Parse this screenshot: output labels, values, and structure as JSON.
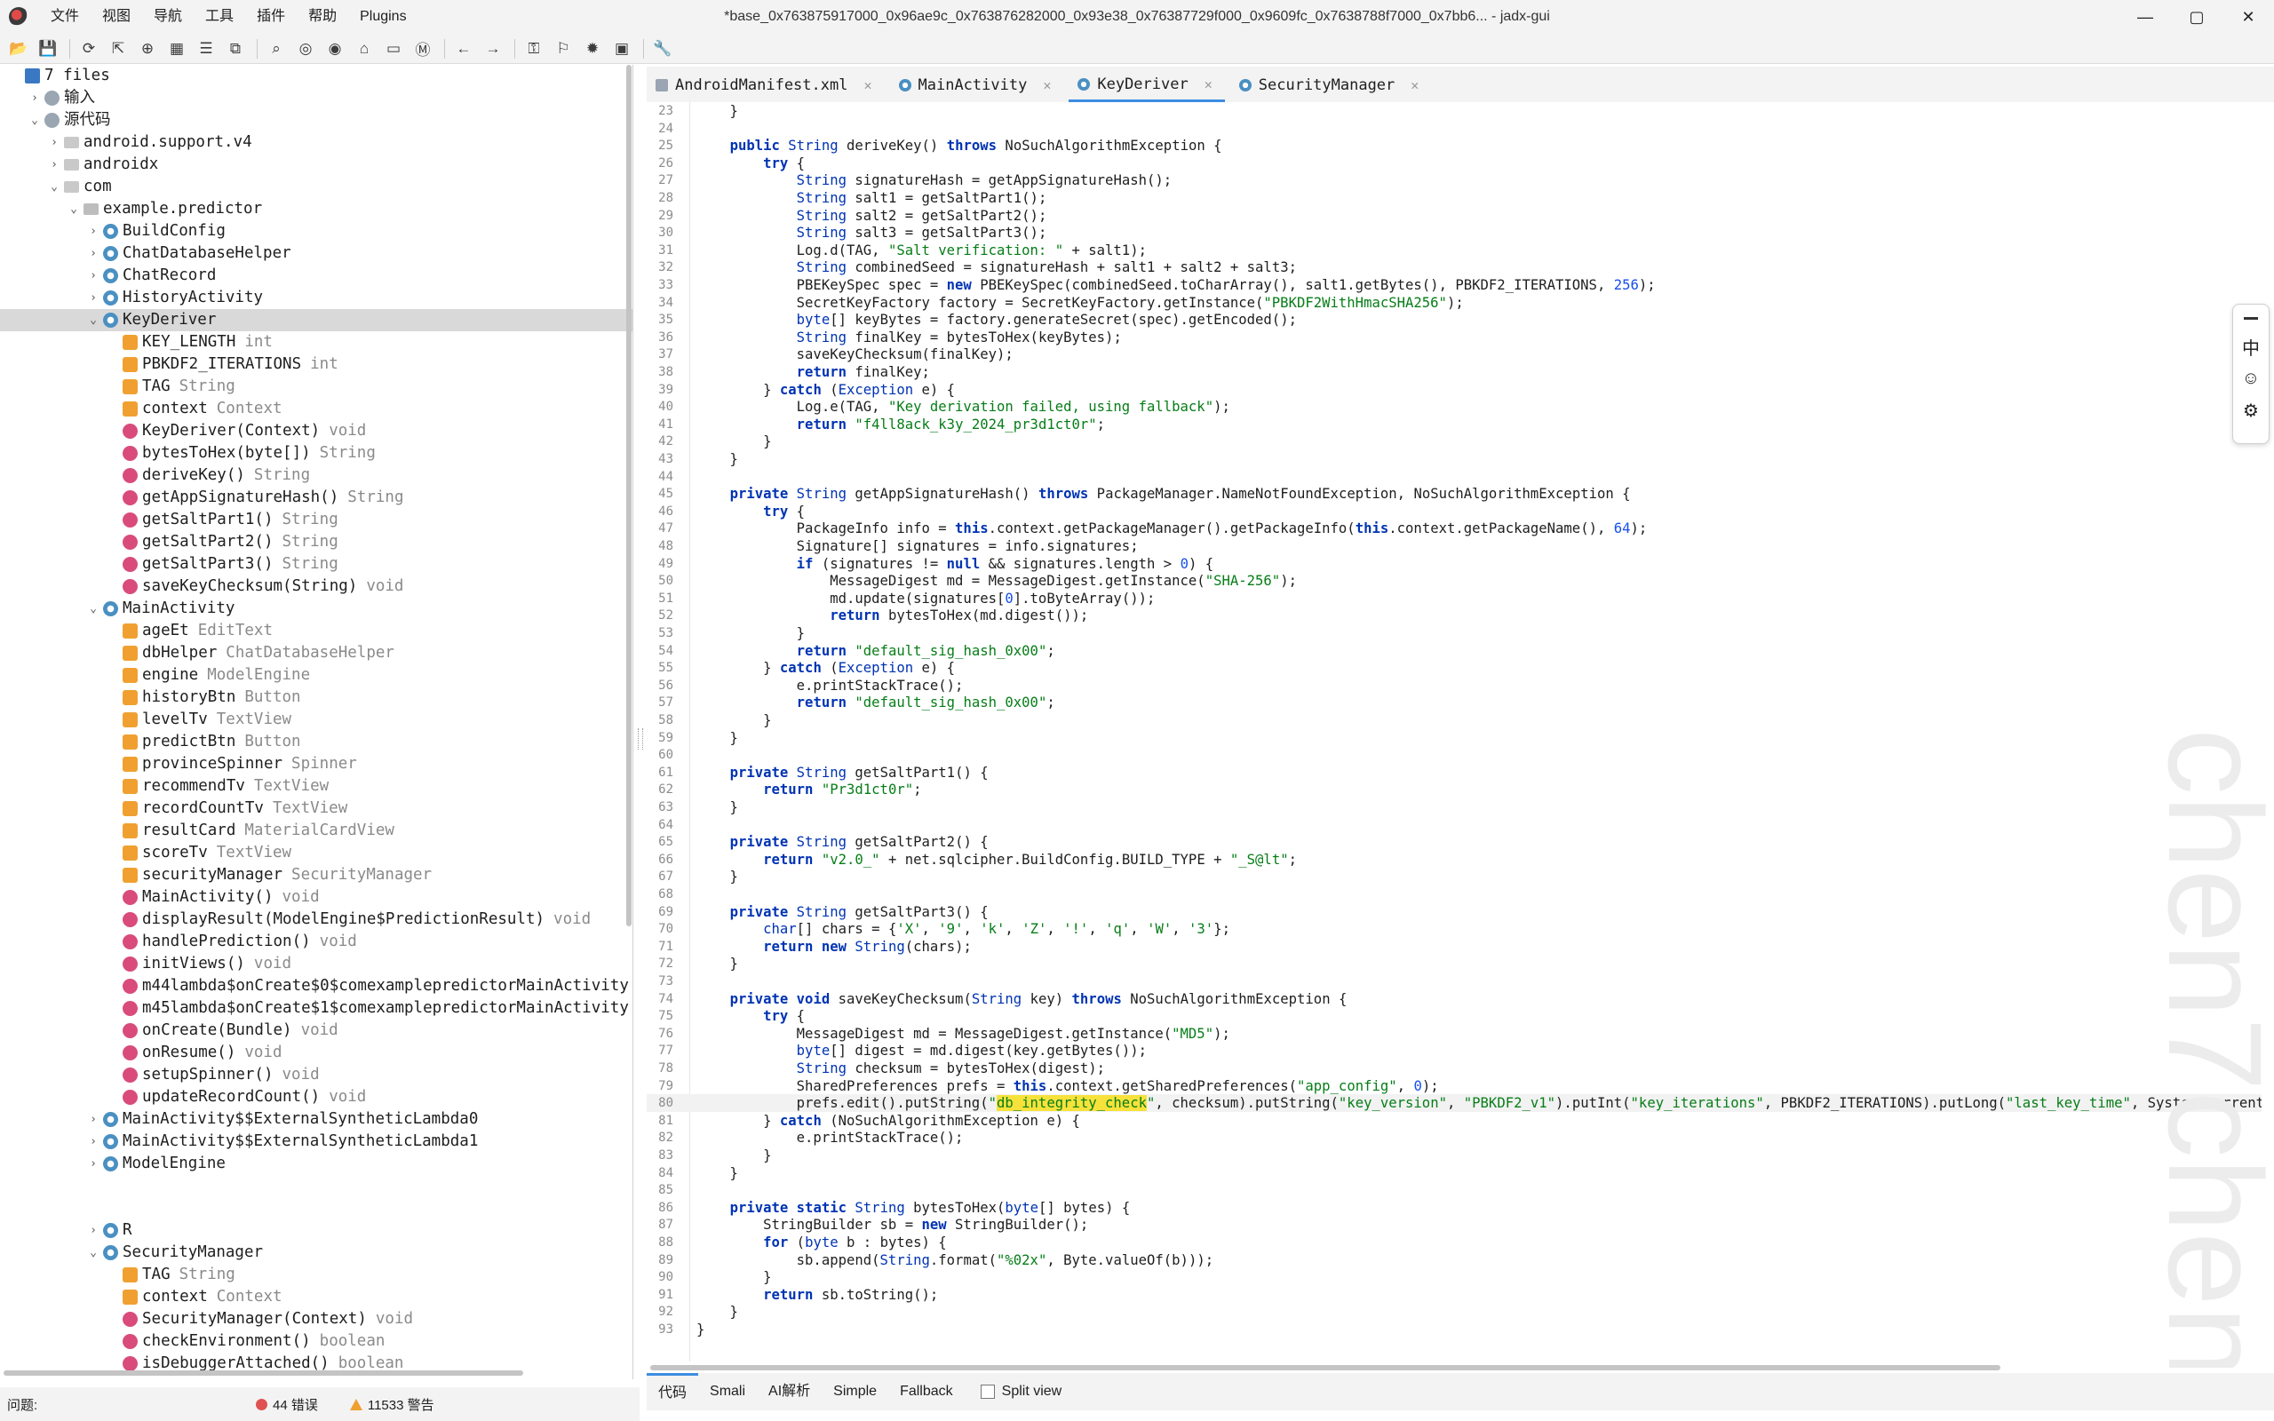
{
  "titlebar": {
    "menus": [
      "文件",
      "视图",
      "导航",
      "工具",
      "插件",
      "帮助",
      "Plugins"
    ],
    "title": "*base_0x763875917000_0x96ae9c_0x763876282000_0x93e38_0x76387729f000_0x9609fc_0x7638788f7000_0x7bb6... - jadx-gui",
    "controls": {
      "minimize": "—",
      "maximize": "▢",
      "close": "✕"
    }
  },
  "toolbar": {
    "icons": [
      "open-file-icon",
      "save-all-icon",
      "sync-icon",
      "export-icon",
      "flatten-icon",
      "package-icon",
      "stack-icon",
      "copy-icon",
      "search-icon",
      "find-usage-icon",
      "search-class-icon",
      "home-icon",
      "decompile-icon",
      "method-icon",
      "back-icon",
      "forward-icon",
      "deobfuscation-icon",
      "bookmark-icon",
      "debug-icon",
      "log-icon",
      "settings-icon"
    ]
  },
  "tree": {
    "rows": [
      {
        "label": "7 files",
        "type": "",
        "indent": 0,
        "icon": "ico-root",
        "arrow": ""
      },
      {
        "label": "输入",
        "type": "",
        "indent": 1,
        "icon": "ico-src",
        "arrow": "›"
      },
      {
        "label": "源代码",
        "type": "",
        "indent": 1,
        "icon": "ico-src",
        "arrow": "⌄"
      },
      {
        "label": "android.support.v4",
        "type": "",
        "indent": 2,
        "icon": "ico-folder",
        "arrow": "›"
      },
      {
        "label": "androidx",
        "type": "",
        "indent": 2,
        "icon": "ico-folder",
        "arrow": "›"
      },
      {
        "label": "com",
        "type": "",
        "indent": 2,
        "icon": "ico-folder",
        "arrow": "⌄"
      },
      {
        "label": "example.predictor",
        "type": "",
        "indent": 3,
        "icon": "ico-pkg",
        "arrow": "⌄"
      },
      {
        "label": "BuildConfig",
        "type": "",
        "indent": 4,
        "icon": "ico-class",
        "arrow": "›"
      },
      {
        "label": "ChatDatabaseHelper",
        "type": "",
        "indent": 4,
        "icon": "ico-class",
        "arrow": "›"
      },
      {
        "label": "ChatRecord",
        "type": "",
        "indent": 4,
        "icon": "ico-class",
        "arrow": "›"
      },
      {
        "label": "HistoryActivity",
        "type": "",
        "indent": 4,
        "icon": "ico-class",
        "arrow": "›"
      },
      {
        "label": "KeyDeriver",
        "type": "",
        "indent": 4,
        "icon": "ico-class",
        "arrow": "⌄",
        "selected": true
      },
      {
        "label": "KEY_LENGTH",
        "type": "int",
        "indent": 5,
        "icon": "ico-field-s",
        "arrow": ""
      },
      {
        "label": "PBKDF2_ITERATIONS",
        "type": "int",
        "indent": 5,
        "icon": "ico-field-s",
        "arrow": ""
      },
      {
        "label": "TAG",
        "type": "String",
        "indent": 5,
        "icon": "ico-field-s",
        "arrow": ""
      },
      {
        "label": "context",
        "type": "Context",
        "indent": 5,
        "icon": "ico-field",
        "arrow": ""
      },
      {
        "label": "KeyDeriver(Context)",
        "type": "void",
        "indent": 5,
        "icon": "ico-method",
        "arrow": ""
      },
      {
        "label": "bytesToHex(byte[])",
        "type": "String",
        "indent": 5,
        "icon": "ico-method",
        "arrow": ""
      },
      {
        "label": "deriveKey()",
        "type": "String",
        "indent": 5,
        "icon": "ico-method",
        "arrow": ""
      },
      {
        "label": "getAppSignatureHash()",
        "type": "String",
        "indent": 5,
        "icon": "ico-method",
        "arrow": ""
      },
      {
        "label": "getSaltPart1()",
        "type": "String",
        "indent": 5,
        "icon": "ico-method",
        "arrow": ""
      },
      {
        "label": "getSaltPart2()",
        "type": "String",
        "indent": 5,
        "icon": "ico-method",
        "arrow": ""
      },
      {
        "label": "getSaltPart3()",
        "type": "String",
        "indent": 5,
        "icon": "ico-method",
        "arrow": ""
      },
      {
        "label": "saveKeyChecksum(String)",
        "type": "void",
        "indent": 5,
        "icon": "ico-method",
        "arrow": ""
      },
      {
        "label": "MainActivity",
        "type": "",
        "indent": 4,
        "icon": "ico-class",
        "arrow": "⌄"
      },
      {
        "label": "ageEt",
        "type": "EditText",
        "indent": 5,
        "icon": "ico-field",
        "arrow": ""
      },
      {
        "label": "dbHelper",
        "type": "ChatDatabaseHelper",
        "indent": 5,
        "icon": "ico-field",
        "arrow": ""
      },
      {
        "label": "engine",
        "type": "ModelEngine",
        "indent": 5,
        "icon": "ico-field",
        "arrow": ""
      },
      {
        "label": "historyBtn",
        "type": "Button",
        "indent": 5,
        "icon": "ico-field",
        "arrow": ""
      },
      {
        "label": "levelTv",
        "type": "TextView",
        "indent": 5,
        "icon": "ico-field",
        "arrow": ""
      },
      {
        "label": "predictBtn",
        "type": "Button",
        "indent": 5,
        "icon": "ico-field",
        "arrow": ""
      },
      {
        "label": "provinceSpinner",
        "type": "Spinner",
        "indent": 5,
        "icon": "ico-field",
        "arrow": ""
      },
      {
        "label": "recommendTv",
        "type": "TextView",
        "indent": 5,
        "icon": "ico-field",
        "arrow": ""
      },
      {
        "label": "recordCountTv",
        "type": "TextView",
        "indent": 5,
        "icon": "ico-field",
        "arrow": ""
      },
      {
        "label": "resultCard",
        "type": "MaterialCardView",
        "indent": 5,
        "icon": "ico-field",
        "arrow": ""
      },
      {
        "label": "scoreTv",
        "type": "TextView",
        "indent": 5,
        "icon": "ico-field",
        "arrow": ""
      },
      {
        "label": "securityManager",
        "type": "SecurityManager",
        "indent": 5,
        "icon": "ico-field",
        "arrow": ""
      },
      {
        "label": "MainActivity()",
        "type": "void",
        "indent": 5,
        "icon": "ico-method",
        "arrow": ""
      },
      {
        "label": "displayResult(ModelEngine$PredictionResult)",
        "type": "void",
        "indent": 5,
        "icon": "ico-method",
        "arrow": ""
      },
      {
        "label": "handlePrediction()",
        "type": "void",
        "indent": 5,
        "icon": "ico-method",
        "arrow": ""
      },
      {
        "label": "initViews()",
        "type": "void",
        "indent": 5,
        "icon": "ico-method",
        "arrow": ""
      },
      {
        "label": "m44lambda$onCreate$0$comexamplepredictorMainActivity",
        "type": "",
        "indent": 5,
        "icon": "ico-method",
        "arrow": ""
      },
      {
        "label": "m45lambda$onCreate$1$comexamplepredictorMainActivity",
        "type": "",
        "indent": 5,
        "icon": "ico-method",
        "arrow": ""
      },
      {
        "label": "onCreate(Bundle)",
        "type": "void",
        "indent": 5,
        "icon": "ico-method",
        "arrow": ""
      },
      {
        "label": "onResume()",
        "type": "void",
        "indent": 5,
        "icon": "ico-method",
        "arrow": ""
      },
      {
        "label": "setupSpinner()",
        "type": "void",
        "indent": 5,
        "icon": "ico-method",
        "arrow": ""
      },
      {
        "label": "updateRecordCount()",
        "type": "void",
        "indent": 5,
        "icon": "ico-method",
        "arrow": ""
      },
      {
        "label": "MainActivity$$ExternalSyntheticLambda0",
        "type": "",
        "indent": 4,
        "icon": "ico-class",
        "arrow": "›"
      },
      {
        "label": "MainActivity$$ExternalSyntheticLambda1",
        "type": "",
        "indent": 4,
        "icon": "ico-class",
        "arrow": "›"
      },
      {
        "label": "ModelEngine",
        "type": "",
        "indent": 4,
        "icon": "ico-class",
        "arrow": "›"
      },
      {
        "label": "",
        "type": "",
        "indent": 4,
        "icon": "",
        "arrow": ""
      },
      {
        "label": "",
        "type": "",
        "indent": 4,
        "icon": "",
        "arrow": ""
      },
      {
        "label": "R",
        "type": "",
        "indent": 4,
        "icon": "ico-class",
        "arrow": "›"
      },
      {
        "label": "SecurityManager",
        "type": "",
        "indent": 4,
        "icon": "ico-class",
        "arrow": "⌄"
      },
      {
        "label": "TAG",
        "type": "String",
        "indent": 5,
        "icon": "ico-field-s",
        "arrow": ""
      },
      {
        "label": "context",
        "type": "Context",
        "indent": 5,
        "icon": "ico-field",
        "arrow": ""
      },
      {
        "label": "SecurityManager(Context)",
        "type": "void",
        "indent": 5,
        "icon": "ico-method",
        "arrow": ""
      },
      {
        "label": "checkEnvironment()",
        "type": "boolean",
        "indent": 5,
        "icon": "ico-method",
        "arrow": ""
      },
      {
        "label": "isDebuggerAttached()",
        "type": "boolean",
        "indent": 5,
        "icon": "ico-method",
        "arrow": ""
      }
    ]
  },
  "editor": {
    "tabs": [
      {
        "label": "AndroidManifest.xml",
        "icon": "xml",
        "active": false
      },
      {
        "label": "MainActivity",
        "icon": "cls",
        "active": false
      },
      {
        "label": "KeyDeriver",
        "icon": "cls",
        "active": true
      },
      {
        "label": "SecurityManager",
        "icon": "cls",
        "active": false
      }
    ],
    "close_glyph": "✕",
    "current_line": 80,
    "lines": [
      {
        "n": 23,
        "code": "    }"
      },
      {
        "n": 24,
        "code": ""
      },
      {
        "n": 25,
        "code": "    public String deriveKey() throws NoSuchAlgorithmException {"
      },
      {
        "n": 26,
        "code": "        try {"
      },
      {
        "n": 27,
        "code": "            String signatureHash = getAppSignatureHash();"
      },
      {
        "n": 28,
        "code": "            String salt1 = getSaltPart1();"
      },
      {
        "n": 29,
        "code": "            String salt2 = getSaltPart2();"
      },
      {
        "n": 30,
        "code": "            String salt3 = getSaltPart3();"
      },
      {
        "n": 31,
        "code": "            Log.d(TAG, \"Salt verification: \" + salt1);"
      },
      {
        "n": 32,
        "code": "            String combinedSeed = signatureHash + salt1 + salt2 + salt3;"
      },
      {
        "n": 33,
        "code": "            PBEKeySpec spec = new PBEKeySpec(combinedSeed.toCharArray(), salt1.getBytes(), PBKDF2_ITERATIONS, 256);"
      },
      {
        "n": 34,
        "code": "            SecretKeyFactory factory = SecretKeyFactory.getInstance(\"PBKDF2WithHmacSHA256\");"
      },
      {
        "n": 35,
        "code": "            byte[] keyBytes = factory.generateSecret(spec).getEncoded();"
      },
      {
        "n": 36,
        "code": "            String finalKey = bytesToHex(keyBytes);"
      },
      {
        "n": 37,
        "code": "            saveKeyChecksum(finalKey);"
      },
      {
        "n": 38,
        "code": "            return finalKey;"
      },
      {
        "n": 39,
        "code": "        } catch (Exception e) {"
      },
      {
        "n": 40,
        "code": "            Log.e(TAG, \"Key derivation failed, using fallback\");"
      },
      {
        "n": 41,
        "code": "            return \"f4ll8ack_k3y_2024_pr3d1ct0r\";"
      },
      {
        "n": 42,
        "code": "        }"
      },
      {
        "n": 43,
        "code": "    }"
      },
      {
        "n": 44,
        "code": ""
      },
      {
        "n": 45,
        "code": "    private String getAppSignatureHash() throws PackageManager.NameNotFoundException, NoSuchAlgorithmException {"
      },
      {
        "n": 46,
        "code": "        try {"
      },
      {
        "n": 47,
        "code": "            PackageInfo info = this.context.getPackageManager().getPackageInfo(this.context.getPackageName(), 64);"
      },
      {
        "n": 48,
        "code": "            Signature[] signatures = info.signatures;"
      },
      {
        "n": 49,
        "code": "            if (signatures != null && signatures.length > 0) {"
      },
      {
        "n": 50,
        "code": "                MessageDigest md = MessageDigest.getInstance(\"SHA-256\");"
      },
      {
        "n": 51,
        "code": "                md.update(signatures[0].toByteArray());"
      },
      {
        "n": 52,
        "code": "                return bytesToHex(md.digest());"
      },
      {
        "n": 53,
        "code": "            }"
      },
      {
        "n": 54,
        "code": "            return \"default_sig_hash_0x00\";"
      },
      {
        "n": 55,
        "code": "        } catch (Exception e) {"
      },
      {
        "n": 56,
        "code": "            e.printStackTrace();"
      },
      {
        "n": 57,
        "code": "            return \"default_sig_hash_0x00\";"
      },
      {
        "n": 58,
        "code": "        }"
      },
      {
        "n": 59,
        "code": "    }"
      },
      {
        "n": 60,
        "code": ""
      },
      {
        "n": 61,
        "code": "    private String getSaltPart1() {"
      },
      {
        "n": 62,
        "code": "        return \"Pr3d1ct0r\";"
      },
      {
        "n": 63,
        "code": "    }"
      },
      {
        "n": 64,
        "code": ""
      },
      {
        "n": 65,
        "code": "    private String getSaltPart2() {"
      },
      {
        "n": 66,
        "code": "        return \"v2.0_\" + net.sqlcipher.BuildConfig.BUILD_TYPE + \"_S@lt\";"
      },
      {
        "n": 67,
        "code": "    }"
      },
      {
        "n": 68,
        "code": ""
      },
      {
        "n": 69,
        "code": "    private String getSaltPart3() {"
      },
      {
        "n": 70,
        "code": "        char[] chars = {'X', '9', 'k', 'Z', '!', 'q', 'W', '3'};"
      },
      {
        "n": 71,
        "code": "        return new String(chars);"
      },
      {
        "n": 72,
        "code": "    }"
      },
      {
        "n": 73,
        "code": ""
      },
      {
        "n": 74,
        "code": "    private void saveKeyChecksum(String key) throws NoSuchAlgorithmException {"
      },
      {
        "n": 75,
        "code": "        try {"
      },
      {
        "n": 76,
        "code": "            MessageDigest md = MessageDigest.getInstance(\"MD5\");"
      },
      {
        "n": 77,
        "code": "            byte[] digest = md.digest(key.getBytes());"
      },
      {
        "n": 78,
        "code": "            String checksum = bytesToHex(digest);"
      },
      {
        "n": 79,
        "code": "            SharedPreferences prefs = this.context.getSharedPreferences(\"app_config\", 0);"
      },
      {
        "n": 80,
        "code": "            prefs.edit().putString(\"db_integrity_check\", checksum).putString(\"key_version\", \"PBKDF2_v1\").putInt(\"key_iterations\", PBKDF2_ITERATIONS).putLong(\"last_key_time\", System.currentTimeMill:"
      },
      {
        "n": 81,
        "code": "        } catch (NoSuchAlgorithmException e) {"
      },
      {
        "n": 82,
        "code": "            e.printStackTrace();"
      },
      {
        "n": 83,
        "code": "        }"
      },
      {
        "n": 84,
        "code": "    }"
      },
      {
        "n": 85,
        "code": ""
      },
      {
        "n": 86,
        "code": "    private static String bytesToHex(byte[] bytes) {"
      },
      {
        "n": 87,
        "code": "        StringBuilder sb = new StringBuilder();"
      },
      {
        "n": 88,
        "code": "        for (byte b : bytes) {"
      },
      {
        "n": 89,
        "code": "            sb.append(String.format(\"%02x\", Byte.valueOf(b)));"
      },
      {
        "n": 90,
        "code": "        }"
      },
      {
        "n": 91,
        "code": "        return sb.toString();"
      },
      {
        "n": 92,
        "code": "    }"
      },
      {
        "n": 93,
        "code": "}"
      }
    ],
    "highlight": "db_integrity_check",
    "watermark": "chen7chen"
  },
  "ime": {
    "mode": "中",
    "emoji": "☺",
    "settings": "⚙"
  },
  "view_tabs": {
    "items": [
      "代码",
      "Smali",
      "AI解析",
      "Simple",
      "Fallback"
    ],
    "active_index": 0,
    "split_view_label": "Split view"
  },
  "status": {
    "label": "问题:",
    "errors": "44 错误",
    "warnings": "11533 警告"
  },
  "colors": {
    "keyword": "#0033b3",
    "string": "#067d17",
    "number": "#1750eb",
    "highlight": "#f7e23b",
    "accent": "#3d8de0"
  }
}
